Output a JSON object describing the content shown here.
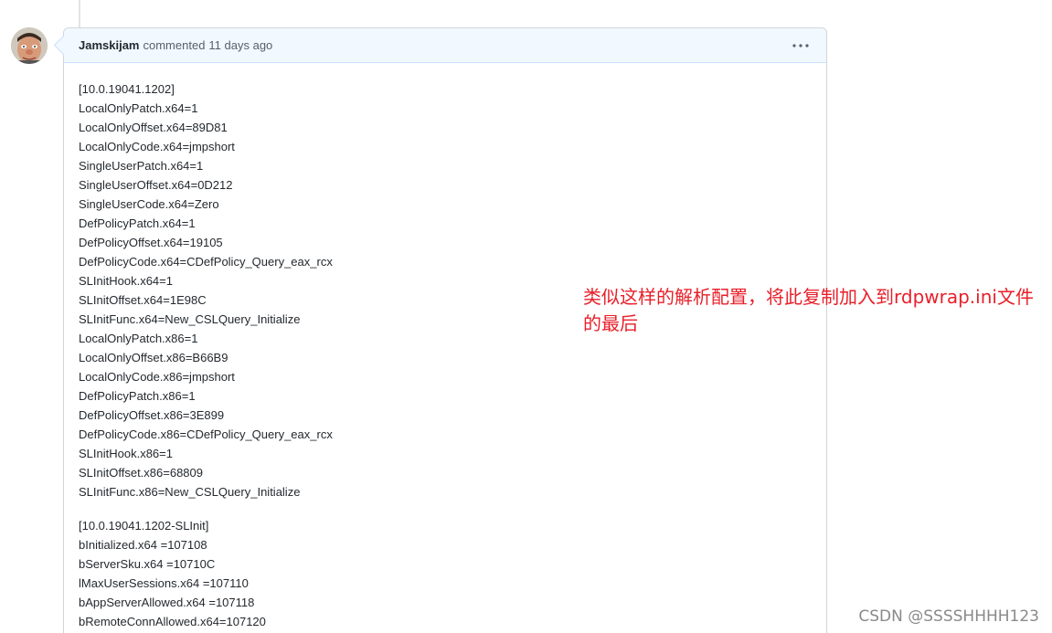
{
  "comment": {
    "author": "Jamskijam",
    "verb": "commented",
    "time": "11 days ago",
    "section1": {
      "header": "[10.0.19041.1202]",
      "lines": [
        "LocalOnlyPatch.x64=1",
        "LocalOnlyOffset.x64=89D81",
        "LocalOnlyCode.x64=jmpshort",
        "SingleUserPatch.x64=1",
        "SingleUserOffset.x64=0D212",
        "SingleUserCode.x64=Zero",
        "DefPolicyPatch.x64=1",
        "DefPolicyOffset.x64=19105",
        "DefPolicyCode.x64=CDefPolicy_Query_eax_rcx",
        "SLInitHook.x64=1",
        "SLInitOffset.x64=1E98C",
        "SLInitFunc.x64=New_CSLQuery_Initialize",
        "LocalOnlyPatch.x86=1",
        "LocalOnlyOffset.x86=B66B9",
        "LocalOnlyCode.x86=jmpshort",
        "DefPolicyPatch.x86=1",
        "DefPolicyOffset.x86=3E899",
        "DefPolicyCode.x86=CDefPolicy_Query_eax_rcx",
        "SLInitHook.x86=1",
        "SLInitOffset.x86=68809",
        "SLInitFunc.x86=New_CSLQuery_Initialize"
      ]
    },
    "section2": {
      "header": "[10.0.19041.1202-SLInit]",
      "lines": [
        "bInitialized.x64 =107108",
        "bServerSku.x64 =10710C",
        "lMaxUserSessions.x64 =107110",
        "bAppServerAllowed.x64 =107118",
        "bRemoteConnAllowed.x64=107120"
      ]
    }
  },
  "annotation": {
    "text": "类似这样的解析配置，将此复制加入到rdpwrap.ini文件的最后"
  },
  "watermark": "CSDN @SSSSHHHH123",
  "icons": {
    "avatar": "user-avatar",
    "menu": "kebab-menu-icon"
  },
  "colors": {
    "annotation": "#e8202a",
    "header_bg": "#f1f8ff",
    "border": "#d1d5da"
  }
}
